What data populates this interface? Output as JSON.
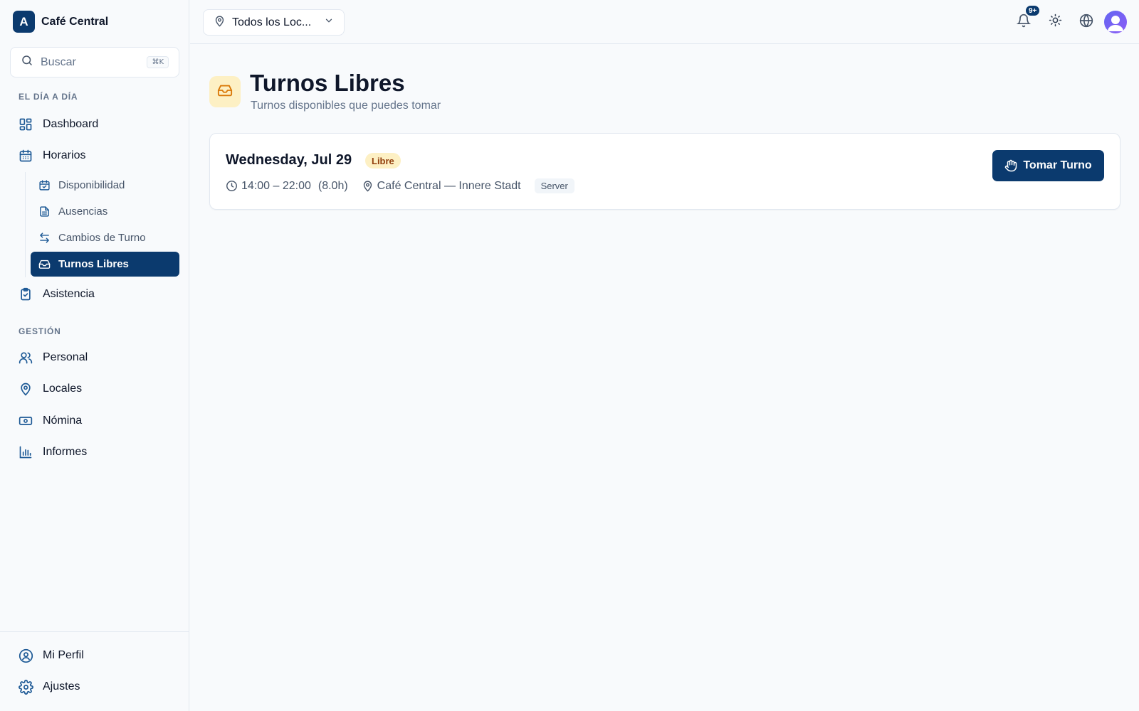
{
  "brand": {
    "logo_letter": "A",
    "name": "Café Central"
  },
  "search": {
    "placeholder": "Buscar",
    "shortcut": "⌘K"
  },
  "sidebar": {
    "section_daily": "EL DÍA A DÍA",
    "dashboard": "Dashboard",
    "horarios": "Horarios",
    "horarios_sub": [
      {
        "label": "Disponibilidad"
      },
      {
        "label": "Ausencias"
      },
      {
        "label": "Cambios de Turno"
      },
      {
        "label": "Turnos Libres",
        "active": true
      }
    ],
    "asistencia": "Asistencia",
    "section_manage": "GESTIÓN",
    "personal": "Personal",
    "locales": "Locales",
    "nomina": "Nómina",
    "informes": "Informes",
    "mi_perfil": "Mi Perfil",
    "ajustes": "Ajustes"
  },
  "topbar": {
    "location_selector": "Todos los Loc...",
    "notification_count": "9+"
  },
  "page": {
    "title": "Turnos Libres",
    "subtitle": "Turnos disponibles que puedes tomar"
  },
  "shifts": [
    {
      "date": "Wednesday, Jul 29",
      "status": "Libre",
      "time": "14:00 – 22:00",
      "duration": "(8.0h)",
      "location": "Café Central — Innere Stadt",
      "role": "Server",
      "action_label": "Tomar Turno"
    }
  ],
  "colors": {
    "primary": "#0b3a6e",
    "accent_soft": "#fdf0c4",
    "accent_text": "#92400e",
    "background": "#f8fafc"
  }
}
